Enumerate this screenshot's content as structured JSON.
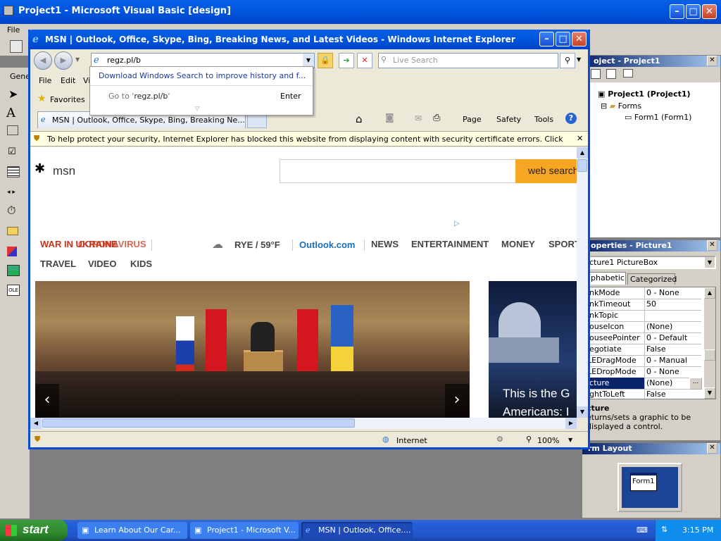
{
  "vb": {
    "title": "Project1 - Microsoft Visual Basic [design]",
    "menu_first": "File",
    "toolbox_label": "Gene",
    "project_panel": {
      "title": "oject - Project1",
      "root": "Project1 (Project1)",
      "folder": "Forms",
      "form": "Form1 (Form1)"
    },
    "properties_panel": {
      "title": "operties - Picture1",
      "object": "cture1 PictureBox",
      "tabs": [
        "lphabetic",
        "Categorized"
      ],
      "rows": [
        {
          "name": "inkMode",
          "value": "0 - None"
        },
        {
          "name": "inkTimeout",
          "value": "50"
        },
        {
          "name": "inkTopic",
          "value": ""
        },
        {
          "name": "louseIcon",
          "value": "(None)"
        },
        {
          "name": "louseePointer",
          "value": "0 - Default"
        },
        {
          "name": "legotiate",
          "value": "False"
        },
        {
          "name": "LEDragMode",
          "value": "0 - Manual"
        },
        {
          "name": "LEDropMode",
          "value": "0 - None"
        },
        {
          "name": "icture",
          "value": "(None)"
        },
        {
          "name": "ightToLeft",
          "value": "False"
        }
      ],
      "desc_title": "cture",
      "desc_text": "eturns/sets a graphic to be displayed a control."
    },
    "form_layout": {
      "title": "rm Layout",
      "form_label": "Form1"
    }
  },
  "ie": {
    "title": "MSN | Outlook, Office, Skype, Bing, Breaking News, and Latest Videos - Windows Internet Explorer",
    "address": "regz.pl/b",
    "search_placeholder": "Live Search",
    "dropdown": {
      "suggestion": "Download Windows Search to improve history and f...",
      "goto_prefix": "Go to '",
      "goto_url": "regz.pl/b",
      "goto_suffix": "'",
      "enter_label": "Enter"
    },
    "menu": [
      "File",
      "Edit",
      "Vi"
    ],
    "favorites": "Favorites",
    "tab_title": "MSN | Outlook, Office, Skype, Bing, Breaking Ne...",
    "tools": {
      "page": "Page",
      "safety": "Safety",
      "tools": "Tools"
    },
    "infobar": "To help protect your security, Internet Explorer has blocked this website from displaying content with security certificate errors. Click here for options...",
    "status_zone": "Internet",
    "zoom": "100%"
  },
  "msn": {
    "logo": "msn",
    "search_button": "web search",
    "war_a": "WAR IN UKRAINE",
    "war_b": "CORONAVIRUS",
    "weather": "RYE / 59°F",
    "outlook": "Outlook.com",
    "nav1": [
      "NEWS",
      "ENTERTAINMENT",
      "MONEY",
      "SPORT"
    ],
    "nav2": [
      "TRAVEL",
      "VIDEO",
      "KIDS"
    ],
    "side_headline_1": "This is the G",
    "side_headline_2": "Americans: I"
  },
  "taskbar": {
    "start": "start",
    "items": [
      "Learn About Our Car...",
      "Project1 - Microsoft V...",
      "MSN | Outlook, Office...."
    ],
    "clock": "3:15 PM"
  },
  "colors": {
    "xp_blue": "#0a5fe6",
    "msn_orange": "#f6a623",
    "msn_red": "#c8341a",
    "msn_blue": "#1a6fb5"
  }
}
